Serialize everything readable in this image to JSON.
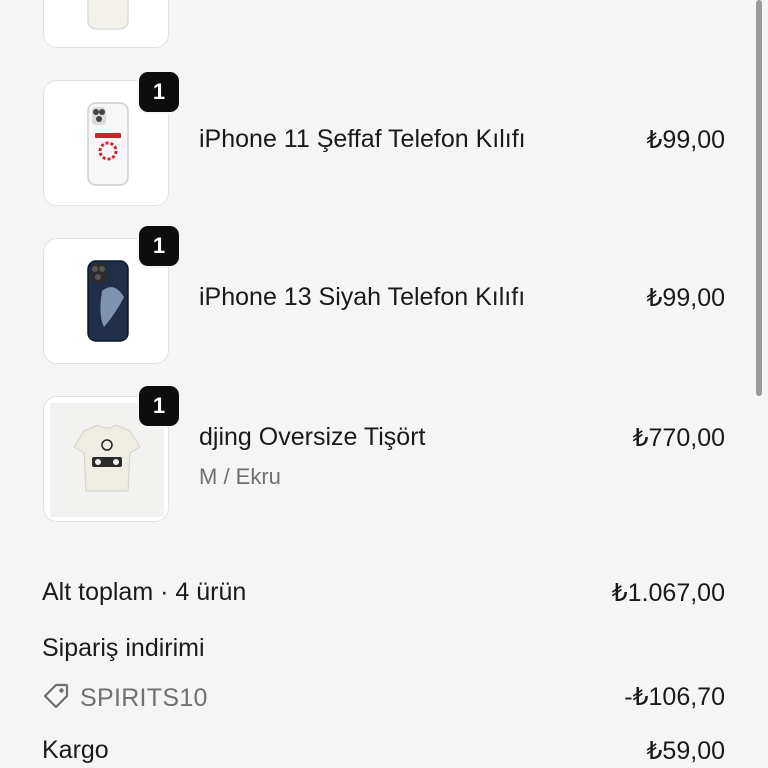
{
  "items": [
    {
      "name": "",
      "price": "",
      "quantity": ""
    },
    {
      "name": "iPhone 11 Şeffaf Telefon Kılıfı",
      "price": "₺99,00",
      "quantity": "1"
    },
    {
      "name": "iPhone 13 Siyah Telefon Kılıfı",
      "price": "₺99,00",
      "quantity": "1"
    },
    {
      "name": "djing Oversize Tişört",
      "variant": "M / Ekru",
      "price": "₺770,00",
      "quantity": "1"
    }
  ],
  "summary": {
    "subtotal_label": "Alt toplam · 4 ürün",
    "subtotal_value": "₺1.067,00",
    "discount_label": "Sipariş indirimi",
    "discount_code": "SPIRITS10",
    "discount_value": "-₺106,70",
    "shipping_label": "Kargo",
    "shipping_value": "₺59,00"
  },
  "icons": {
    "discount": "tag-icon"
  },
  "colors": {
    "background": "#f5f5f5",
    "badge": "#0d0d0d",
    "muted_text": "#707070"
  }
}
